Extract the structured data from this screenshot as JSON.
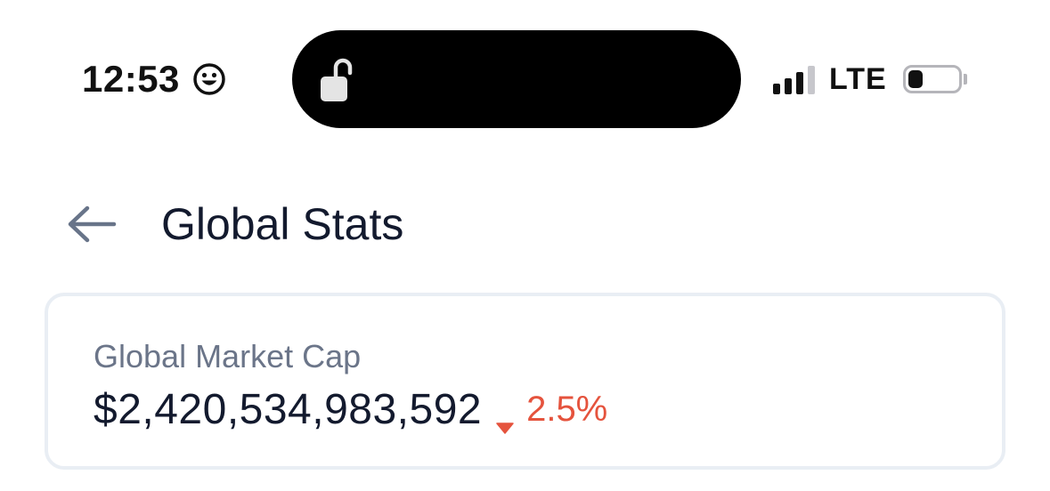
{
  "status_bar": {
    "time": "12:53",
    "time_icon": "smiley-icon",
    "lock_icon": "unlocked-padlock-icon",
    "network": "LTE",
    "signal_bars_active": 3,
    "signal_bars_total": 4,
    "battery_level": 0.3
  },
  "header": {
    "back_icon": "arrow-left-icon",
    "title": "Global Stats"
  },
  "market_card": {
    "label": "Global Market Cap",
    "value": "$2,420,534,983,592",
    "change": "2.5%",
    "change_direction": "down",
    "change_icon": "caret-down-icon"
  },
  "colors": {
    "text_primary": "#131a2e",
    "text_secondary": "#6b7589",
    "negative": "#e5533d",
    "card_border": "#e9eef4",
    "back_arrow": "#687489"
  }
}
